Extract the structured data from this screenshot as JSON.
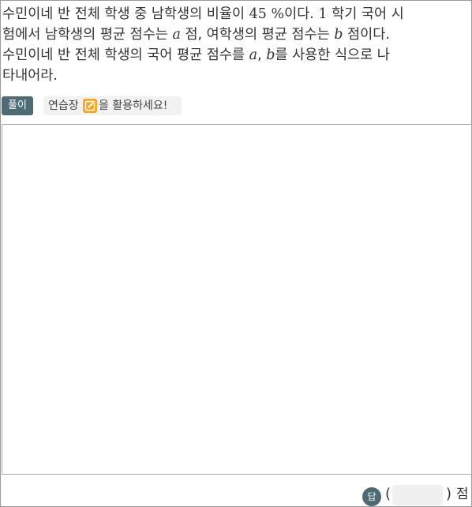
{
  "question": {
    "line1": {
      "before": "수민이네 반 전체 학생 중 남학생의 비율이 ",
      "percent": "45 %",
      "middle": "이다. ",
      "semester": "1",
      "after": " 학기 국어 시"
    },
    "line2": {
      "before": "험에서 남학생의 평균 점수는 ",
      "var_a": "a",
      "middle": " 점, 여학생의 평균 점수는 ",
      "var_b": "b",
      "after": " 점이다."
    },
    "line3": {
      "before": "수민이네 반 전체 학생의 국어 평균 점수를 ",
      "var_a": "a",
      "comma": ", ",
      "var_b": "b",
      "after": "를 사용한 식으로 나"
    },
    "line4": "타내어라."
  },
  "toolbar": {
    "solution_label": "풀이",
    "hint_prefix": "연습장",
    "hint_suffix": "을 활용하세요!"
  },
  "answer": {
    "badge": "답",
    "open_paren": "(",
    "close_paren": ")",
    "value": "",
    "unit": "점"
  },
  "colors": {
    "badge_bg": "#4d6a75",
    "hint_bg": "#f2f2f2",
    "pencil_bg": "#f5a623",
    "input_bg": "#f0f0f0"
  },
  "icons": {
    "pencil": "pencil-icon"
  }
}
